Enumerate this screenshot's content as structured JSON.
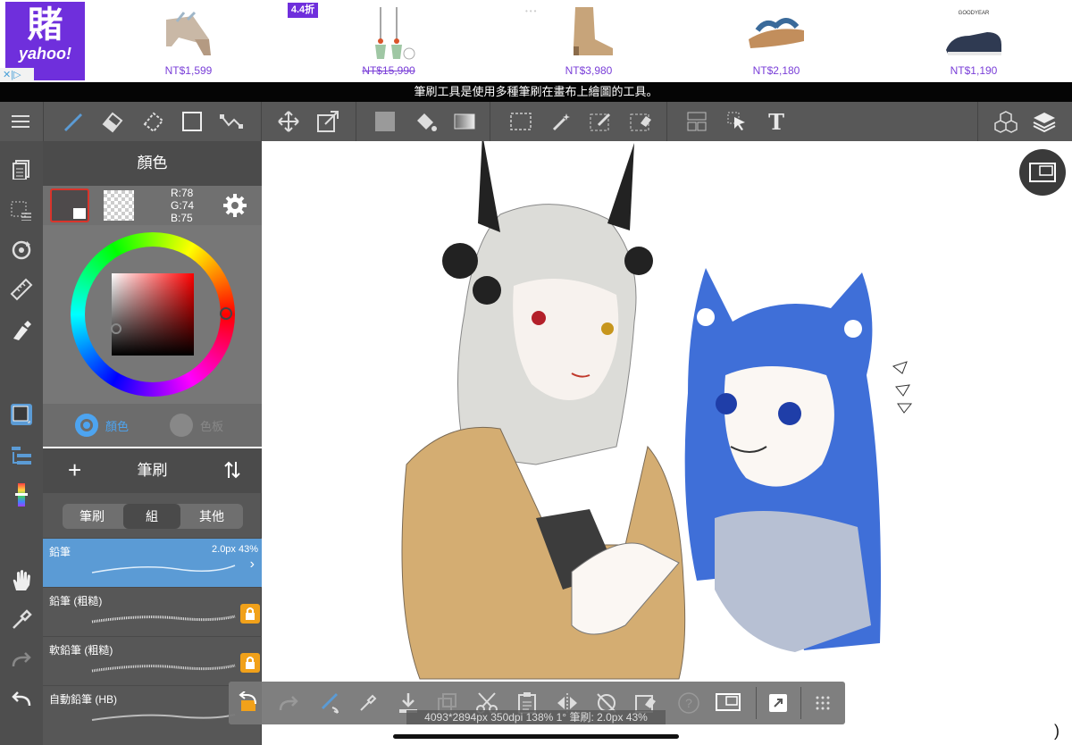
{
  "ad": {
    "logo_big": "賭",
    "logo_small": "yahoo!",
    "badge": "4.4折",
    "close_label": "✕|▷",
    "products": [
      {
        "name": "sandal-1",
        "price": "NT$1,599",
        "strike": false
      },
      {
        "name": "earrings",
        "price": "NT$15,990",
        "strike": true
      },
      {
        "name": "boots",
        "price": "NT$3,980",
        "strike": false
      },
      {
        "name": "sandal-2",
        "price": "NT$2,180",
        "strike": false
      },
      {
        "name": "boat-shoe",
        "price": "NT$1,190",
        "strike": false
      }
    ]
  },
  "hint": "筆刷工具是使用多種筆刷在畫布上繪圖的工具。",
  "toolbar": {
    "text_tool_label": "T"
  },
  "color_panel": {
    "title": "顏色",
    "r": "R:78",
    "g": "G:74",
    "b": "B:75",
    "tab_color": "顏色",
    "tab_palette": "色板",
    "current_color": "#4e4a4b"
  },
  "brush_panel": {
    "title": "筆刷",
    "seg": [
      "筆刷",
      "組",
      "其他"
    ],
    "brushes": [
      {
        "name": "鉛筆",
        "meta": "2.0px 43%",
        "locked": false,
        "selected": true
      },
      {
        "name": "鉛筆 (粗糙)",
        "meta": "",
        "locked": true,
        "selected": false
      },
      {
        "name": "軟鉛筆 (粗糙)",
        "meta": "",
        "locked": true,
        "selected": false
      },
      {
        "name": "自動鉛筆 (HB)",
        "meta": "",
        "locked": true,
        "selected": false
      }
    ]
  },
  "status": "4093*2894px 350dpi 138% 1° 筆刷: 2.0px 43%",
  "colors": {
    "accent": "#5b9bd5",
    "toolbar": "#585858",
    "lock": "#f1a11a",
    "ad_purple": "#6f2fdc"
  }
}
